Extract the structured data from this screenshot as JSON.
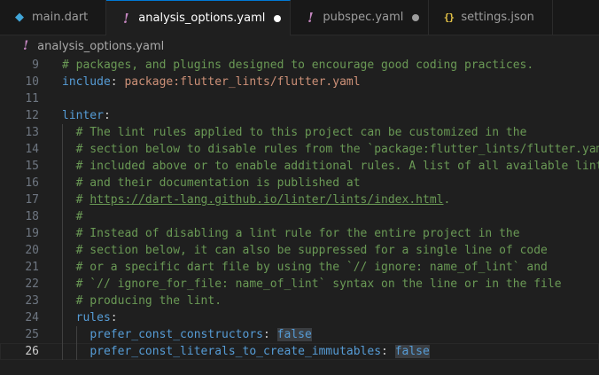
{
  "tabs": [
    {
      "label": "main.dart",
      "icon": "dart-icon",
      "dirty": false,
      "active": false
    },
    {
      "label": "analysis_options.yaml",
      "icon": "yaml-icon",
      "dirty": true,
      "active": true
    },
    {
      "label": "pubspec.yaml",
      "icon": "yaml-icon",
      "dirty": true,
      "active": false
    },
    {
      "label": "settings.json",
      "icon": "json-icon",
      "dirty": false,
      "active": false
    }
  ],
  "breadcrumb": {
    "file": "analysis_options.yaml",
    "icon": "yaml-icon"
  },
  "editor": {
    "current_line": 26,
    "lines": [
      {
        "n": "9",
        "parts": [
          {
            "t": "# packages, and plugins designed to encourage good coding practices.",
            "c": "comment"
          }
        ]
      },
      {
        "n": "10",
        "parts": [
          {
            "t": "include",
            "c": "key"
          },
          {
            "t": ": ",
            "c": "plain"
          },
          {
            "t": "package:flutter_lints/flutter.yaml",
            "c": "str"
          }
        ]
      },
      {
        "n": "11",
        "parts": []
      },
      {
        "n": "12",
        "parts": [
          {
            "t": "linter",
            "c": "key"
          },
          {
            "t": ":",
            "c": "plain"
          }
        ]
      },
      {
        "n": "13",
        "parts": [
          {
            "t": "  ",
            "c": "plain"
          },
          {
            "t": "# The lint rules applied to this project can be customized in the",
            "c": "comment"
          }
        ]
      },
      {
        "n": "14",
        "parts": [
          {
            "t": "  ",
            "c": "plain"
          },
          {
            "t": "# section below to disable rules from the `package:flutter_lints/flutter.yaml`",
            "c": "comment"
          }
        ]
      },
      {
        "n": "15",
        "parts": [
          {
            "t": "  ",
            "c": "plain"
          },
          {
            "t": "# included above or to enable additional rules. A list of all available lints",
            "c": "comment"
          }
        ]
      },
      {
        "n": "16",
        "parts": [
          {
            "t": "  ",
            "c": "plain"
          },
          {
            "t": "# and their documentation is published at",
            "c": "comment"
          }
        ]
      },
      {
        "n": "17",
        "parts": [
          {
            "t": "  ",
            "c": "plain"
          },
          {
            "t": "# ",
            "c": "comment"
          },
          {
            "t": "https://dart-lang.github.io/linter/lints/index.html",
            "c": "link"
          },
          {
            "t": ".",
            "c": "comment"
          }
        ]
      },
      {
        "n": "18",
        "parts": [
          {
            "t": "  ",
            "c": "plain"
          },
          {
            "t": "#",
            "c": "comment"
          }
        ]
      },
      {
        "n": "19",
        "parts": [
          {
            "t": "  ",
            "c": "plain"
          },
          {
            "t": "# Instead of disabling a lint rule for the entire project in the",
            "c": "comment"
          }
        ]
      },
      {
        "n": "20",
        "parts": [
          {
            "t": "  ",
            "c": "plain"
          },
          {
            "t": "# section below, it can also be suppressed for a single line of code",
            "c": "comment"
          }
        ]
      },
      {
        "n": "21",
        "parts": [
          {
            "t": "  ",
            "c": "plain"
          },
          {
            "t": "# or a specific dart file by using the `// ignore: name_of_lint` and",
            "c": "comment"
          }
        ]
      },
      {
        "n": "22",
        "parts": [
          {
            "t": "  ",
            "c": "plain"
          },
          {
            "t": "# `// ignore_for_file: name_of_lint` syntax on the line or in the file",
            "c": "comment"
          }
        ]
      },
      {
        "n": "23",
        "parts": [
          {
            "t": "  ",
            "c": "plain"
          },
          {
            "t": "# producing the lint.",
            "c": "comment"
          }
        ]
      },
      {
        "n": "24",
        "parts": [
          {
            "t": "  ",
            "c": "plain"
          },
          {
            "t": "rules",
            "c": "key"
          },
          {
            "t": ":",
            "c": "plain"
          }
        ]
      },
      {
        "n": "25",
        "parts": [
          {
            "t": "    ",
            "c": "plain"
          },
          {
            "t": "prefer_const_constructors",
            "c": "key"
          },
          {
            "t": ": ",
            "c": "plain"
          },
          {
            "t": "false",
            "c": "bool"
          }
        ]
      },
      {
        "n": "26",
        "parts": [
          {
            "t": "    ",
            "c": "plain"
          },
          {
            "t": "prefer_const_literals_to_create_immutables",
            "c": "key"
          },
          {
            "t": ": ",
            "c": "plain"
          },
          {
            "t": "false",
            "c": "bool"
          }
        ]
      }
    ]
  },
  "colors": {
    "background": "#1f1f1f",
    "tabbar": "#181818",
    "active_tab_border": "#0078d4",
    "comment": "#6a9955",
    "key": "#569cd6",
    "string": "#ce9178"
  }
}
